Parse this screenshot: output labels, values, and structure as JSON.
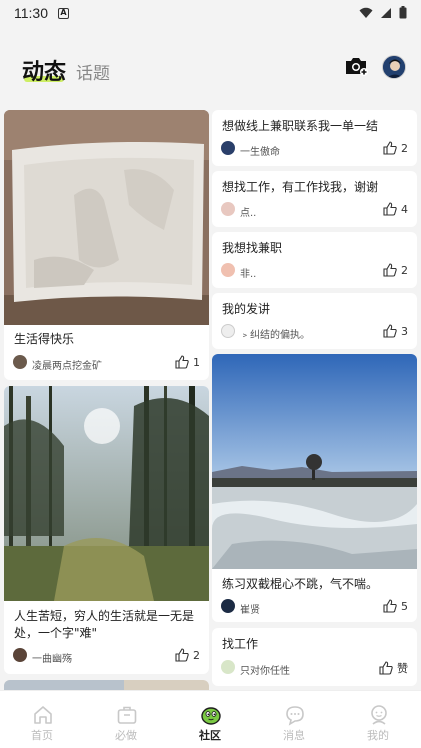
{
  "status_bar": {
    "time": "11:30",
    "app_badge": "A"
  },
  "header": {
    "active_tab": "动态",
    "inactive_tab": "话题"
  },
  "left_column": [
    {
      "title": "生活得快乐",
      "user": "凌晨两点挖金矿",
      "likes": "1"
    },
    {
      "title": "人生苦短，穷人的生活就是一无是处，一个字\"难\"",
      "user": "一曲幽殇",
      "likes": "2"
    }
  ],
  "right_column": [
    {
      "title": "想做线上兼职联系我一单一结",
      "user": "一生傲命",
      "likes": "2"
    },
    {
      "title": "想找工作，有工作找我，谢谢",
      "user": "点..",
      "likes": "4"
    },
    {
      "title": "我想找兼职",
      "user": "非..",
      "likes": "2"
    },
    {
      "title": "我的发讲",
      "user": "﹥纠结的偏执。",
      "likes": "3"
    },
    {
      "title": "练习双截棍心不跳，气不喘。",
      "user": "崔贤",
      "likes": "5"
    },
    {
      "title": "找工作",
      "user": "只对你任性",
      "likes": "赞"
    }
  ],
  "bottom_nav": [
    {
      "label": "首页",
      "icon": "home-icon"
    },
    {
      "label": "必做",
      "icon": "briefcase-icon"
    },
    {
      "label": "社区",
      "icon": "community-icon"
    },
    {
      "label": "消息",
      "icon": "message-icon"
    },
    {
      "label": "我的",
      "icon": "profile-icon"
    }
  ],
  "colors": {
    "accent": "#c6ec4a",
    "background": "#f3f3f3",
    "card": "#ffffff"
  }
}
